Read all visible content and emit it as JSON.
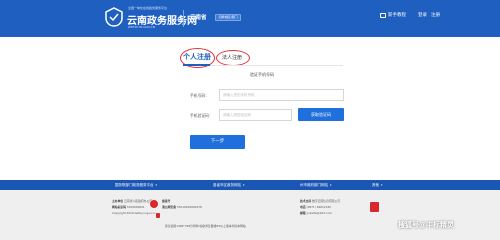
{
  "header": {
    "site_subtitle": "全国一体化在线政务服务平台",
    "site_title": "云南政务服务网",
    "site_url": "ZWFW.YN.GOV.CN",
    "region": "云南省",
    "switch_region": "切换地区/部门",
    "nav_guide": "新手教程",
    "nav_login": "登录",
    "nav_register": "注册",
    "brand_color": "#1f5fbf"
  },
  "tabs": {
    "personal": "个人注册",
    "legal": "法人注册",
    "annotation_color": "#e3313a"
  },
  "form": {
    "section_title": "验证手机号码",
    "phone_label": "手机号码：",
    "phone_placeholder": "请输入您的手机号码",
    "code_label": "手机验证码：",
    "code_placeholder": "请输入短信验证码",
    "get_code_button": "获取验证码",
    "next_button": "下一步",
    "button_color": "#1f6fdc"
  },
  "footer": {
    "links": [
      {
        "label": "国务院部门政务服务平台"
      },
      {
        "label": "各省市区政务网站"
      },
      {
        "label": "州市政府部门网站"
      },
      {
        "label": "其他"
      }
    ],
    "host_label": "主办单位",
    "host_value": "云南省人民政府办公厅",
    "website_code_label": "网站标识码",
    "website_code_value": "5300000001",
    "copyright": "Copyright 2019 zwfw.yn.gov.cn",
    "security_label": "滇公网安备",
    "security_value": "53010202000478",
    "tech_label": "技术支持",
    "tech_value": "数字云南信息有限公司",
    "phone_label": "电话",
    "phone_value": "(0871) 64612345",
    "email_label": "邮箱",
    "email_value": "ynzwfw@163.com",
    "record_label": "备案号",
    "record_value": "滇ICP备",
    "bottom_note": "建议使用1366*768分辨率/谷歌浏览器或IE9以上版本浏览本网站"
  },
  "watermark": "搜狐号@中标精灵"
}
